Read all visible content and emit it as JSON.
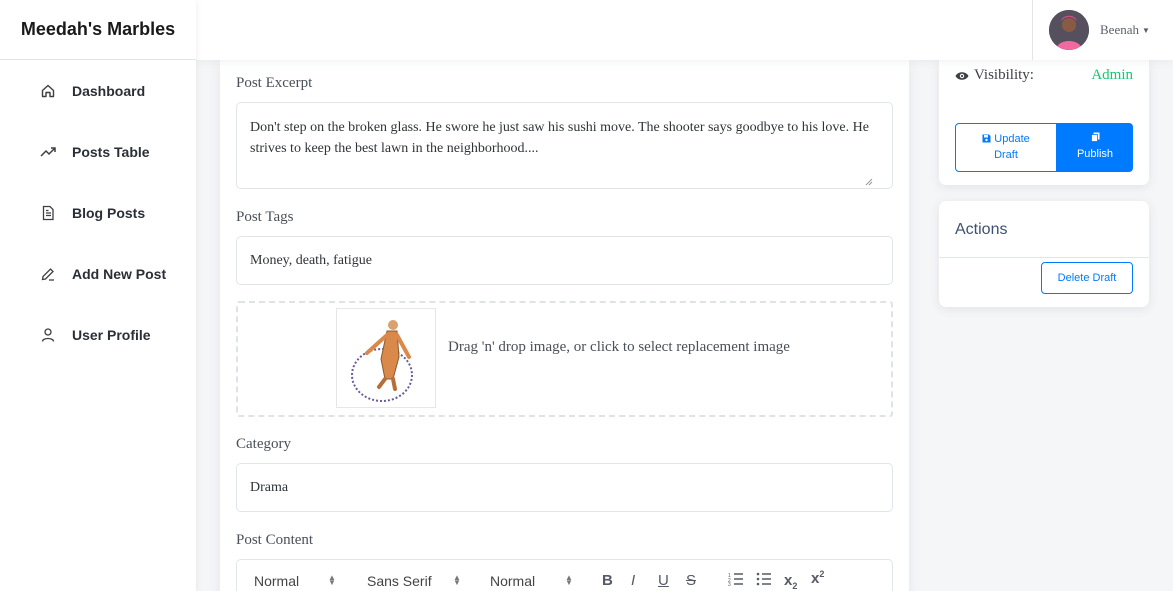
{
  "brand": "Meedah's Marbles",
  "sidebar": {
    "items": [
      {
        "label": "Dashboard",
        "icon": "home-icon"
      },
      {
        "label": "Posts Table",
        "icon": "trending-icon"
      },
      {
        "label": "Blog Posts",
        "icon": "document-icon"
      },
      {
        "label": "Add New Post",
        "icon": "pencil-icon"
      },
      {
        "label": "User Profile",
        "icon": "user-icon"
      }
    ]
  },
  "user": {
    "name": "Beenah"
  },
  "form": {
    "excerpt_label": "Post Excerpt",
    "excerpt_value": "Don't step on the broken glass. He swore he just saw his sushi move. The shooter says goodbye to his love. He strives to keep the best lawn in the neighborhood....",
    "tags_label": "Post Tags",
    "tags_value": "Money, death, fatigue",
    "dropzone_text": "Drag 'n' drop image, or click to select replacement image",
    "category_label": "Category",
    "category_value": "Drama",
    "content_label": "Post Content"
  },
  "editor": {
    "header_select": "Normal",
    "font_select": "Sans Serif",
    "size_select": "Normal",
    "buttons": [
      "B",
      "I",
      "U",
      "S"
    ]
  },
  "publish_card": {
    "visibility_label": "Visibility:",
    "visibility_value": "Admin",
    "update_line1": "Update",
    "update_line2": "Draft",
    "publish_label": "Publish"
  },
  "actions_card": {
    "title": "Actions",
    "delete_label": "Delete Draft"
  },
  "colors": {
    "primary": "#007bff",
    "success": "#17c671"
  }
}
